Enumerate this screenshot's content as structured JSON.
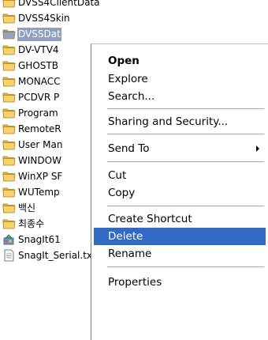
{
  "files": [
    {
      "label": "DVSS4ClientData",
      "type": "folder",
      "icon": "folder-icon",
      "selected": false
    },
    {
      "label": "DVSS4Skin",
      "type": "folder",
      "icon": "folder-icon",
      "selected": false
    },
    {
      "label": "DVSSDat",
      "type": "folder",
      "icon": "folder-icon",
      "selected": true
    },
    {
      "label": "DV-VTV4",
      "type": "folder",
      "icon": "folder-icon",
      "selected": false
    },
    {
      "label": "GHOSTB",
      "type": "folder",
      "icon": "folder-icon",
      "selected": false
    },
    {
      "label": "MONACC",
      "type": "folder",
      "icon": "folder-icon",
      "selected": false
    },
    {
      "label": "PCDVR P",
      "type": "folder",
      "icon": "folder-icon",
      "selected": false
    },
    {
      "label": "Program",
      "type": "folder",
      "icon": "folder-icon",
      "selected": false
    },
    {
      "label": "RemoteR",
      "type": "folder",
      "icon": "folder-icon",
      "selected": false
    },
    {
      "label": "User Man",
      "type": "folder",
      "icon": "folder-icon",
      "selected": false
    },
    {
      "label": "WINDOW",
      "type": "folder",
      "icon": "folder-icon",
      "selected": false
    },
    {
      "label": "WinXP SF",
      "type": "folder",
      "icon": "folder-icon",
      "selected": false
    },
    {
      "label": "WUTemp",
      "type": "folder",
      "icon": "folder-icon",
      "selected": false
    },
    {
      "label": "백신",
      "type": "folder",
      "icon": "folder-icon",
      "selected": false
    },
    {
      "label": "최종수",
      "type": "folder",
      "icon": "folder-icon",
      "selected": false
    },
    {
      "label": "SnagIt61",
      "type": "exe",
      "icon": "installer-icon",
      "selected": false
    },
    {
      "label": "SnagIt_Serial.txt",
      "type": "txt",
      "icon": "text-file-icon",
      "selected": false
    }
  ],
  "context_menu": {
    "open": "Open",
    "explore": "Explore",
    "search": "Search...",
    "sharing": "Sharing and Security...",
    "send_to": "Send To",
    "cut": "Cut",
    "copy": "Copy",
    "create_shortcut": "Create Shortcut",
    "delete": "Delete",
    "rename": "Rename",
    "properties": "Properties",
    "highlighted": "Delete"
  },
  "colors": {
    "selection_bg": "#8f9fbf",
    "menu_highlight": "#316ac5",
    "folder": "#f6d26a"
  }
}
